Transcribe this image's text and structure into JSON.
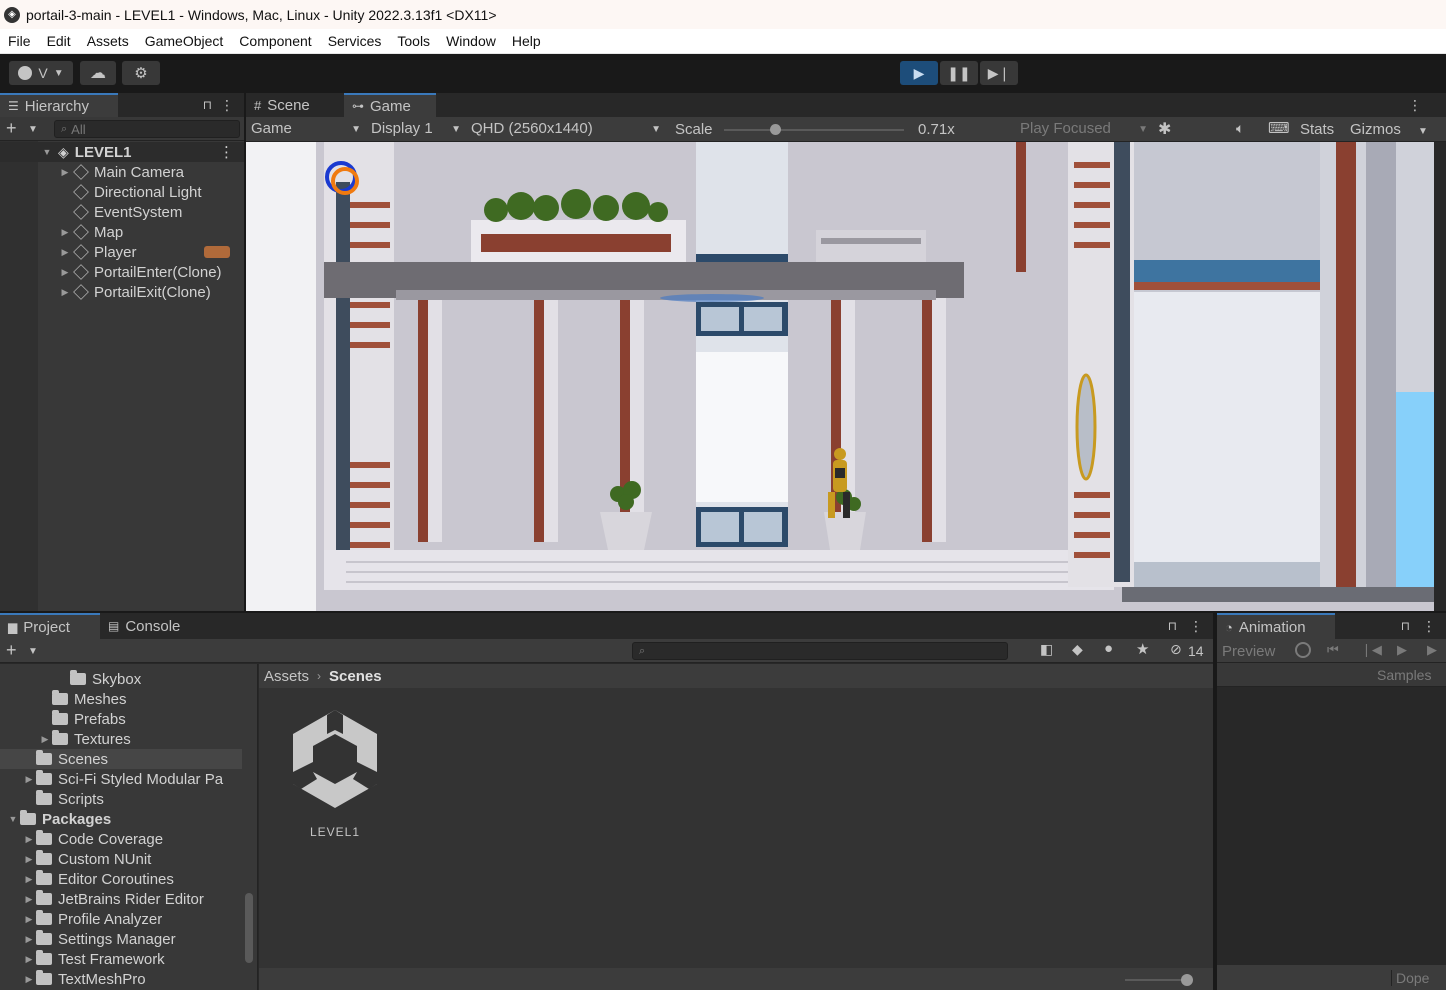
{
  "window": {
    "title": "portail-3-main - LEVEL1 - Windows, Mac, Linux - Unity 2022.3.13f1 <DX11>"
  },
  "menu": [
    "File",
    "Edit",
    "Assets",
    "GameObject",
    "Component",
    "Services",
    "Tools",
    "Window",
    "Help"
  ],
  "toolbar": {
    "account_label": "V",
    "play_icon": "play-icon",
    "pause_icon": "pause-icon",
    "step_icon": "step-icon"
  },
  "hierarchy": {
    "tab_label": "Hierarchy",
    "search_placeholder": "All",
    "scene_name": "LEVEL1",
    "items": [
      {
        "label": "Main Camera",
        "expandable": true
      },
      {
        "label": "Directional Light",
        "expandable": false
      },
      {
        "label": "EventSystem",
        "expandable": false
      },
      {
        "label": "Map",
        "expandable": true
      },
      {
        "label": "Player",
        "expandable": true
      },
      {
        "label": "PortailEnter(Clone)",
        "expandable": true
      },
      {
        "label": "PortailExit(Clone)",
        "expandable": true
      }
    ]
  },
  "game_view": {
    "tabs": [
      "Scene",
      "Game"
    ],
    "active_tab": "Game",
    "view_select": "Game",
    "display_select": "Display 1",
    "resolution_select": "QHD (2560x1440)",
    "scale_label": "Scale",
    "scale_value": "0.71x",
    "play_mode": "Play Focused",
    "stats_label": "Stats",
    "gizmos_label": "Gizmos"
  },
  "project": {
    "tabs": [
      "Project",
      "Console"
    ],
    "active_tab": "Project",
    "hidden_count": "14",
    "breadcrumb": [
      "Assets",
      "Scenes"
    ],
    "tree": [
      {
        "label": "Skybox",
        "indent": 3,
        "expandable": false,
        "selected": false
      },
      {
        "label": "Meshes",
        "indent": 2,
        "expandable": false,
        "selected": false
      },
      {
        "label": "Prefabs",
        "indent": 2,
        "expandable": false,
        "selected": false
      },
      {
        "label": "Textures",
        "indent": 2,
        "expandable": true,
        "selected": false
      },
      {
        "label": "Scenes",
        "indent": 1,
        "expandable": false,
        "selected": true
      },
      {
        "label": "Sci-Fi Styled Modular Pa",
        "indent": 1,
        "expandable": true,
        "selected": false
      },
      {
        "label": "Scripts",
        "indent": 1,
        "expandable": false,
        "selected": false
      },
      {
        "label": "Packages",
        "indent": 0,
        "expandable": true,
        "expanded": true,
        "selected": false,
        "bold": true
      },
      {
        "label": "Code Coverage",
        "indent": 1,
        "expandable": true,
        "selected": false
      },
      {
        "label": "Custom NUnit",
        "indent": 1,
        "expandable": true,
        "selected": false
      },
      {
        "label": "Editor Coroutines",
        "indent": 1,
        "expandable": true,
        "selected": false
      },
      {
        "label": "JetBrains Rider Editor",
        "indent": 1,
        "expandable": true,
        "selected": false
      },
      {
        "label": "Profile Analyzer",
        "indent": 1,
        "expandable": true,
        "selected": false
      },
      {
        "label": "Settings Manager",
        "indent": 1,
        "expandable": true,
        "selected": false
      },
      {
        "label": "Test Framework",
        "indent": 1,
        "expandable": true,
        "selected": false
      },
      {
        "label": "TextMeshPro",
        "indent": 1,
        "expandable": true,
        "selected": false
      }
    ],
    "asset": {
      "label": "LEVEL1",
      "icon": "unity-scene-icon"
    }
  },
  "animation": {
    "tab_label": "Animation",
    "preview_label": "Preview",
    "samples_label": "Samples",
    "dope_label": "Dope"
  },
  "colors": {
    "accent": "#3a79bb",
    "play_active": "#1d4d7a",
    "panel": "#383838",
    "toolbar": "#191919"
  }
}
